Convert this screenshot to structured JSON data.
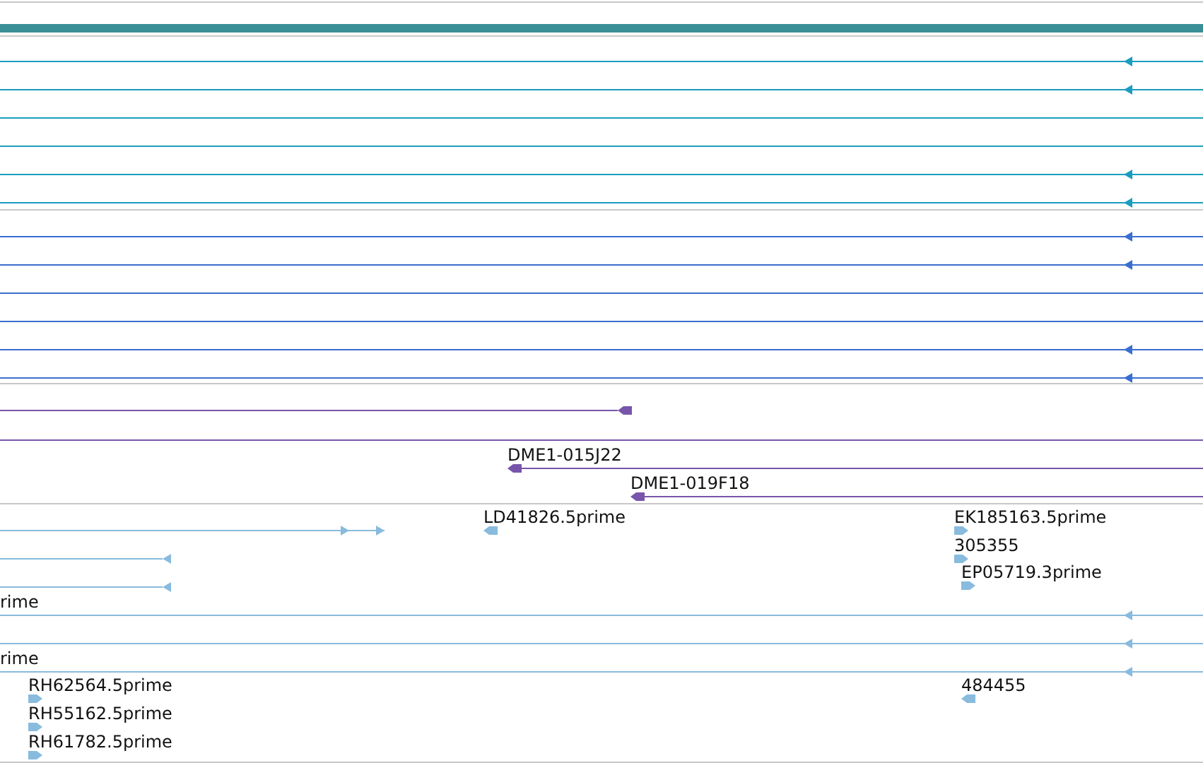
{
  "tracks": [
    {
      "color": "#1a9dc0",
      "features": [
        {
          "kind": "reverse"
        },
        {
          "kind": "reverse"
        },
        {
          "kind": "plain"
        },
        {
          "kind": "plain"
        },
        {
          "kind": "reverse"
        },
        {
          "kind": "reverse"
        }
      ]
    },
    {
      "color": "#3a6ed0",
      "features": [
        {
          "kind": "reverse"
        },
        {
          "kind": "reverse"
        },
        {
          "kind": "plain"
        },
        {
          "kind": "plain"
        },
        {
          "kind": "reverse"
        },
        {
          "kind": "reverse"
        }
      ]
    },
    {
      "color": "#7755aa",
      "features": [
        {
          "kind": "reverse"
        },
        {
          "kind": "plain"
        },
        {
          "label": "DME1-015J22",
          "kind": "reverse"
        },
        {
          "label": "DME1-019F18",
          "kind": "reverse"
        }
      ]
    },
    {
      "color": "#88bbdd",
      "features": [
        {
          "kind": "forward"
        },
        {
          "label": "LD41826.5prime",
          "kind": "reverse"
        },
        {
          "label": "EK185163.5prime",
          "kind": "forward"
        },
        {
          "kind": "reverse"
        },
        {
          "label": "305355",
          "kind": "forward"
        },
        {
          "kind": "reverse"
        },
        {
          "label": "EP05719.3prime",
          "kind": "forward"
        },
        {
          "label": "rime",
          "kind": "reverse"
        },
        {
          "kind": "reverse"
        },
        {
          "label": "rime",
          "kind": "reverse"
        },
        {
          "label": "RH62564.5prime",
          "kind": "forward"
        },
        {
          "label": "484455",
          "kind": "reverse"
        },
        {
          "label": "RH55162.5prime",
          "kind": "forward"
        },
        {
          "label": "RH61782.5prime",
          "kind": "forward"
        }
      ]
    }
  ]
}
